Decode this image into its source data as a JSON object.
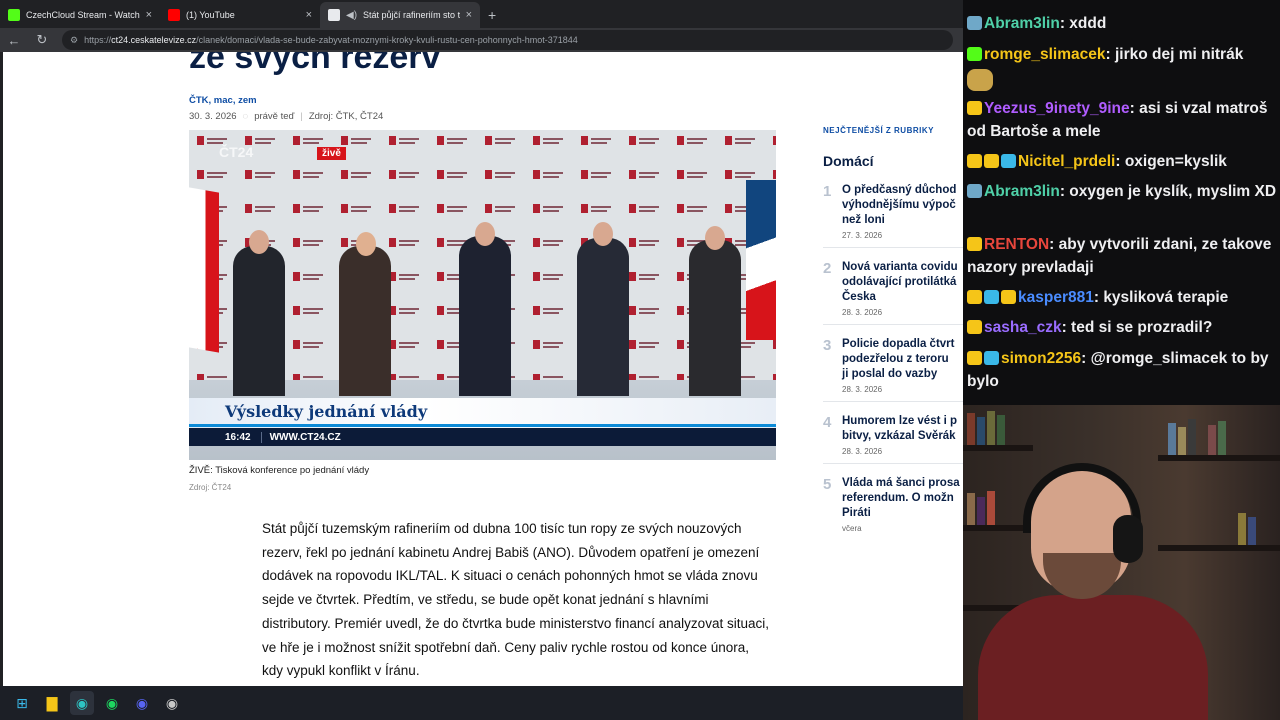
{
  "browser": {
    "tabs": [
      {
        "label": "CzechCloud Stream - Watch Live o",
        "icon": "kick-icon",
        "color": "#53fc18"
      },
      {
        "label": "(1) YouTube",
        "icon": "youtube-icon",
        "color": "#ff0000"
      },
      {
        "label": "Stát půjčí rafineriím sto tisíc",
        "icon": "ct24-icon",
        "color": "#e8eaed",
        "active": true
      }
    ],
    "url_prefix": "https://",
    "url_host": "ct24.ceskatelevize.cz",
    "url_path": "/clanek/domaci/vlada-se-bude-zabyvat-moznymi-kroky-kvuli-rustu-cen-pohonnych-hmot-371844"
  },
  "article": {
    "headline_fragment": "ze svých rezerv",
    "authors": "ČTK, mac, zem",
    "date": "30. 3. 2026",
    "updated": "právě teď",
    "source": "Zdroj: ČTK, ČT24",
    "video": {
      "live_badge": "živě",
      "channel_logo": "ČT24",
      "lower_third": "Výsledky jednání vlády",
      "time": "16:42",
      "site": "WWW.CT24.CZ"
    },
    "caption": "ŽIVĚ: Tisková konference po jednání vlády",
    "caption_source": "Zdroj: ČT24",
    "body": "Stát půjčí tuzemským rafineriím od dubna 100 tisíc tun ropy ze svých nouzových rezerv, řekl po jednání kabinetu Andrej Babiš (ANO). Důvodem opatření je omezení dodávek na ropovodu IKL/TAL. K situaci o cenách pohonných hmot se vláda znovu sejde ve čtvrtek. Předtím, ve středu, se bude opět konat jednání s hlavními distributory. Premiér uvedl, že do čtvrtka bude ministerstvo financí analyzovat situaci, ve hře je i možnost snížit spotřební daň. Ceny paliv rychle rostou od konce února, kdy vypukl konflikt v Íránu."
  },
  "sidebar": {
    "label": "NEJČTENĚJŠÍ Z RUBRIKY",
    "title": "Domácí",
    "items": [
      {
        "num": "1",
        "title": "O předčasný důchod\nvýhodnějšímu výpoč\nnež loni",
        "date": "27. 3. 2026"
      },
      {
        "num": "2",
        "title": "Nová varianta covidu\nodolávající protilátká\nČeska",
        "date": "28. 3. 2026"
      },
      {
        "num": "3",
        "title": "Policie dopadla čtvrt\npodezřelou z teroru\nji poslal do vazby",
        "date": "28. 3. 2026"
      },
      {
        "num": "4",
        "title": "Humorem lze vést i p\nbitvy, vzkázal Svěrák",
        "date": "28. 3. 2026"
      },
      {
        "num": "5",
        "title": "Vláda má šanci prosa\nreferendum. O možn\nPiráti",
        "date": "včera"
      }
    ]
  },
  "chat": [
    {
      "badges": [
        "#6fa8c8"
      ],
      "user": "Abram3lin",
      "color": "#4fd0a8",
      "text": "xddd"
    },
    {
      "badges": [
        "#53fc18"
      ],
      "user": "romge_slimacek",
      "color": "#f5c518",
      "text": "jirko dej mi nitrák"
    },
    {
      "badges": [
        "#f5c518"
      ],
      "user": "Yeezus_9inety_9ine",
      "color": "#b05cff",
      "text": "asi si vzal matroš od Bartoše a mele"
    },
    {
      "badges": [
        "#f5c518",
        "#f5c518",
        "#3ab8e8"
      ],
      "user": "Nicitel_prdeli",
      "color": "#f5c518",
      "text": "oxigen=kyslik"
    },
    {
      "badges": [
        "#6fa8c8"
      ],
      "user": "Abram3lin",
      "color": "#4fd0a8",
      "text": "oxygen je kyslík, myslim XD"
    },
    {
      "badges": [
        "#f5c518"
      ],
      "user": "RENTON",
      "color": "#e8463c",
      "text": "aby vytvorili zdani, ze takove nazory prevladaji"
    },
    {
      "badges": [
        "#f5c518",
        "#3ab8e8",
        "#f5c518"
      ],
      "user": "kasper881",
      "color": "#4a8cff",
      "text": "kysliková terapie"
    },
    {
      "badges": [
        "#f5c518"
      ],
      "user": "sasha_czk",
      "color": "#9a6cff",
      "text": "ted si se prozradil?"
    },
    {
      "badges": [
        "#f5c518",
        "#3ab8e8"
      ],
      "user": "simon2256",
      "color": "#f5c518",
      "text": "@romge_slimacek to by bylo"
    }
  ],
  "taskbar": [
    {
      "name": "windows-start-icon",
      "glyph": "⊞",
      "color": "#3ab8e8"
    },
    {
      "name": "file-explorer-icon",
      "glyph": "▇",
      "color": "#f5c518"
    },
    {
      "name": "edge-browser-icon",
      "glyph": "◉",
      "color": "#2ec3c3"
    },
    {
      "name": "spotify-icon",
      "glyph": "◉",
      "color": "#1ed760"
    },
    {
      "name": "discord-icon",
      "glyph": "◉",
      "color": "#5865f2"
    },
    {
      "name": "obs-icon",
      "glyph": "◉",
      "color": "#c8c8c8"
    }
  ]
}
